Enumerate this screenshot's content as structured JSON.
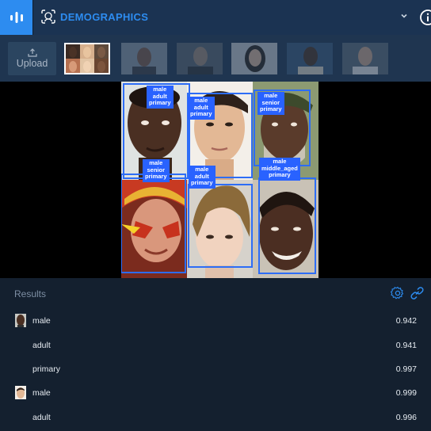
{
  "header": {
    "title": "DEMOGRAPHICS",
    "logo_icon": "bars-logo-icon",
    "model_icon": "face-scan-icon",
    "dropdown_icon": "chevron-down-icon",
    "info_icon": "info-icon"
  },
  "strip": {
    "upload_label": "Upload",
    "upload_icon": "upload-icon",
    "thumbnails": [
      "face-grid",
      "man-beard",
      "man-gray",
      "woman-smile",
      "man-dark",
      "man-young"
    ]
  },
  "detections": [
    {
      "lines": [
        "male",
        "adult",
        "primary"
      ]
    },
    {
      "lines": [
        "male",
        "adult",
        "primary"
      ]
    },
    {
      "lines": [
        "male",
        "senior",
        "primary"
      ]
    },
    {
      "lines": [
        "male",
        "senior",
        "primary"
      ]
    },
    {
      "lines": [
        "male",
        "adult",
        "primary"
      ]
    },
    {
      "lines": [
        "male",
        "middle_aged",
        "primary"
      ]
    }
  ],
  "results": {
    "title": "Results",
    "settings_icon": "gear-icon",
    "link_icon": "link-icon",
    "rows": [
      {
        "name": "male",
        "score": "0.942",
        "avatar": true
      },
      {
        "name": "adult",
        "score": "0.941",
        "avatar": false
      },
      {
        "name": "primary",
        "score": "0.997",
        "avatar": false
      },
      {
        "name": "male",
        "score": "0.999",
        "avatar": true
      },
      {
        "name": "adult",
        "score": "0.996",
        "avatar": false
      }
    ]
  },
  "colors": {
    "accent": "#2d8cf0",
    "header_bg": "#1b3352",
    "box": "#2d6df6",
    "label_bg": "#2962ff",
    "results_bg": "#14202f"
  }
}
